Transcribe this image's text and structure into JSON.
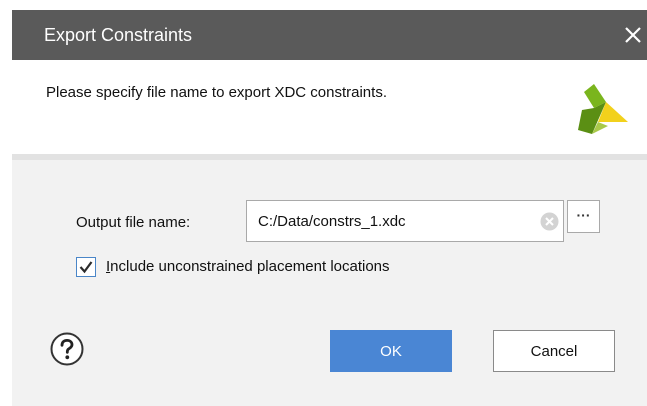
{
  "dialog": {
    "title": "Export Constraints",
    "close_icon": "close-icon",
    "message": "Please specify file name to export XDC constraints.",
    "logo_icon": "xilinx-logo-icon"
  },
  "form": {
    "output_label": "Output file name:",
    "output_value": "C:/Data/constrs_1.xdc",
    "clear_icon": "clear-circle-icon",
    "browse_label": "···",
    "include_checkbox": {
      "checked": true,
      "label_mnemonic": "I",
      "label_rest": "nclude unconstrained placement locations"
    }
  },
  "footer": {
    "help_icon": "help-icon",
    "ok_label": "OK",
    "cancel_label": "Cancel"
  },
  "colors": {
    "titlebar": "#5a5a5a",
    "primary_button": "#4a86d4",
    "checkbox_border": "#4a86c8",
    "logo_green": "#7ab51d",
    "logo_yellow": "#f2d11c"
  }
}
